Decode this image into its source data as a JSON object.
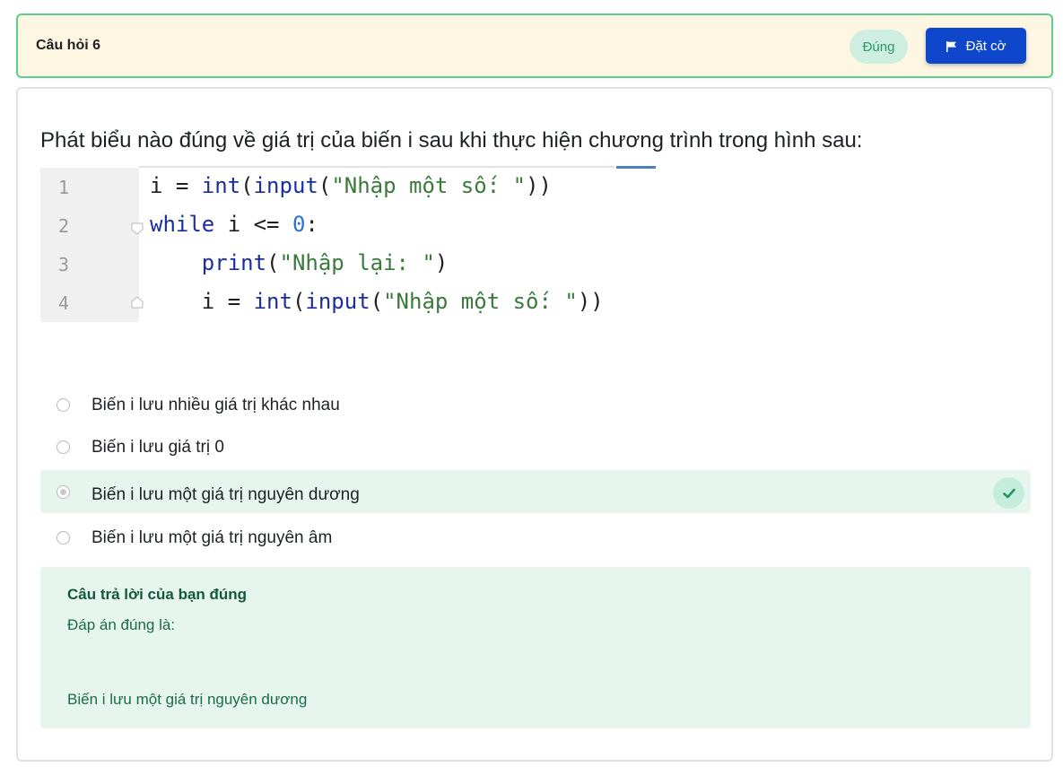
{
  "header": {
    "title": "Câu hỏi 6",
    "status": "Đúng",
    "flag_label": "Đặt cờ"
  },
  "question": {
    "text": "Phát biểu nào đúng về giá trị của biến i sau khi thực hiện chương trình trong hình sau:"
  },
  "code": {
    "line_numbers": [
      "1",
      "2",
      "3",
      "4"
    ],
    "lines": [
      "i = int(input(\"Nhập một số: \"))",
      "while i <= 0:",
      "    print(\"Nhập lại: \")",
      "    i = int(input(\"Nhập một số: \"))"
    ]
  },
  "answers": [
    {
      "label": "Biến i lưu nhiều giá trị khác nhau",
      "selected": false
    },
    {
      "label": "Biến i lưu giá trị 0",
      "selected": false
    },
    {
      "label": "Biến i lưu một giá trị nguyên dương",
      "selected": true,
      "correct": true
    },
    {
      "label": "Biến i lưu một giá trị nguyên âm",
      "selected": false
    }
  ],
  "feedback": {
    "title": "Câu trả lời của bạn đúng",
    "correct_label": "Đáp án đúng là:",
    "correct_answer": "Biến i lưu một giá trị nguyên dương"
  },
  "colors": {
    "header_bg": "#fdf6e3",
    "header_border": "#5cd08a",
    "flag_button": "#0f47cc",
    "correct_bg": "#e6f6ef",
    "correct_text": "#1b6b47"
  },
  "icons": {
    "flag": "flag-icon",
    "check": "check-icon"
  }
}
